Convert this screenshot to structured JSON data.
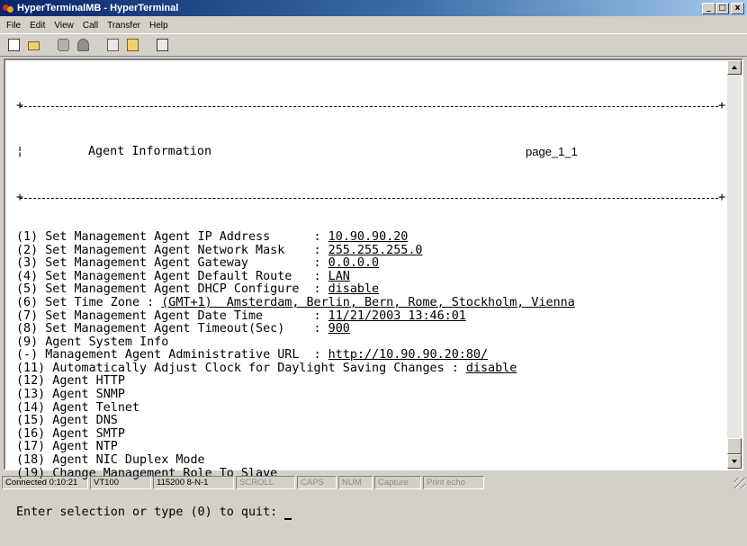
{
  "window": {
    "title": "HyperTerminalMB - HyperTerminal"
  },
  "caption_buttons": {
    "minimize": "_",
    "maximize": "□",
    "close": "x"
  },
  "menu": [
    "File",
    "Edit",
    "View",
    "Call",
    "Transfer",
    "Help"
  ],
  "toolbar": {
    "buttons": [
      "new-icon",
      "open-icon",
      "call-icon",
      "disconnect-icon",
      "send-icon",
      "receive-icon",
      "properties-icon"
    ]
  },
  "terminal": {
    "header_title": "Agent Information",
    "header_page": "page_1_1",
    "rows": [
      {
        "num": "(1)",
        "label": " Set Management Agent IP Address      : ",
        "value": "10.90.90.20"
      },
      {
        "num": "(2)",
        "label": " Set Management Agent Network Mask    : ",
        "value": "255.255.255.0"
      },
      {
        "num": "(3)",
        "label": " Set Management Agent Gateway         : ",
        "value": "0.0.0.0"
      },
      {
        "num": "(4)",
        "label": " Set Management Agent Default Route   : ",
        "value": "LAN"
      },
      {
        "num": "(5)",
        "label": " Set Management Agent DHCP Configure  : ",
        "value": "disable"
      },
      {
        "num": "(6)",
        "label": " Set Time Zone : ",
        "value": "(GMT+1)  Amsterdam, Berlin, Bern, Rome, Stockholm, Vienna"
      },
      {
        "num": "(7)",
        "label": " Set Management Agent Date Time       : ",
        "value": "11/21/2003 13:46:01"
      },
      {
        "num": "(8)",
        "label": " Set Management Agent Timeout(Sec)    : ",
        "value": "900"
      },
      {
        "num": "(9)",
        "label": " Agent System Info",
        "value": ""
      },
      {
        "num": "(-)",
        "label": " Management Agent Administrative URL  : ",
        "value": "http://10.90.90.20:80/"
      },
      {
        "num": "(11)",
        "label": " Automatically Adjust Clock for Daylight Saving Changes : ",
        "value": "disable"
      },
      {
        "num": "(12)",
        "label": " Agent HTTP",
        "value": ""
      },
      {
        "num": "(13)",
        "label": " Agent SNMP",
        "value": ""
      },
      {
        "num": "(14)",
        "label": " Agent Telnet",
        "value": ""
      },
      {
        "num": "(15)",
        "label": " Agent DNS",
        "value": ""
      },
      {
        "num": "(16)",
        "label": " Agent SMTP",
        "value": ""
      },
      {
        "num": "(17)",
        "label": " Agent NTP",
        "value": ""
      },
      {
        "num": "(18)",
        "label": " Agent NIC Duplex Mode",
        "value": ""
      },
      {
        "num": "(19)",
        "label": " Change Management Role To Slave",
        "value": ""
      }
    ],
    "prompt": "Enter selection or type (0) to quit: "
  },
  "status": {
    "connected": "Connected 0:10:21",
    "emulation": "VT100",
    "settings": "115200 8-N-1",
    "scroll": "SCROLL",
    "caps": "CAPS",
    "num": "NUM",
    "capture": "Capture",
    "print_echo": "Print echo"
  },
  "colors": {
    "titlebar_start": "#0a246a",
    "titlebar_end": "#a6caf0",
    "chrome": "#d4d0c8"
  }
}
